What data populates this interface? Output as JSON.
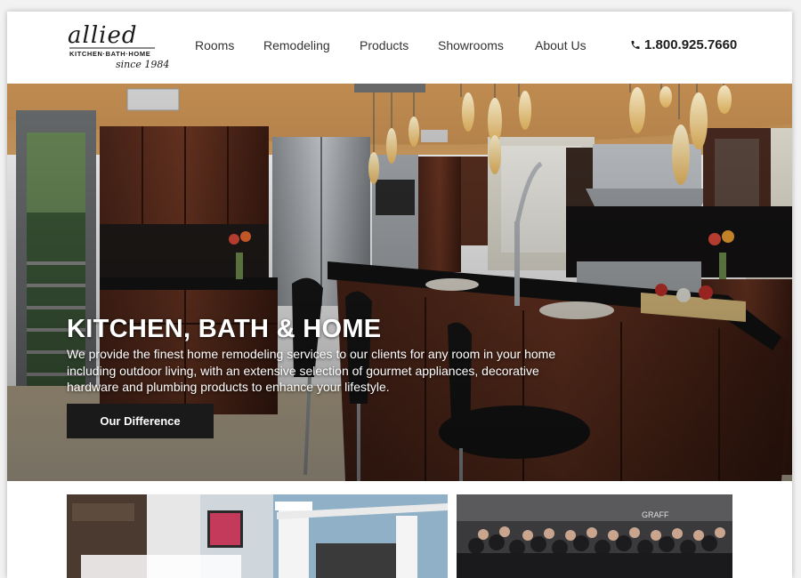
{
  "brand": {
    "logo_script": "allied",
    "logo_tagline": "KITCHEN·BATH·HOME",
    "logo_since": "since 1984"
  },
  "nav": {
    "items": [
      {
        "label": "Rooms"
      },
      {
        "label": "Remodeling"
      },
      {
        "label": "Products"
      },
      {
        "label": "Showrooms"
      },
      {
        "label": "About Us"
      }
    ],
    "phone": "1.800.925.7660",
    "phone_icon": "phone-icon"
  },
  "hero": {
    "title": "KITCHEN, BATH & HOME",
    "text": "We provide the finest home remodeling services to our clients for any room in your home including outdoor living, with an extensive selection of gourmet appliances, decorative hardware and plumbing products to enhance your lifestyle.",
    "button_label": "Our Difference"
  },
  "thumbnails": {
    "left_sign": "GRAFF"
  },
  "colors": {
    "button_bg": "#1a1a1a",
    "text_dark": "#333333",
    "hero_text": "#ffffff"
  }
}
